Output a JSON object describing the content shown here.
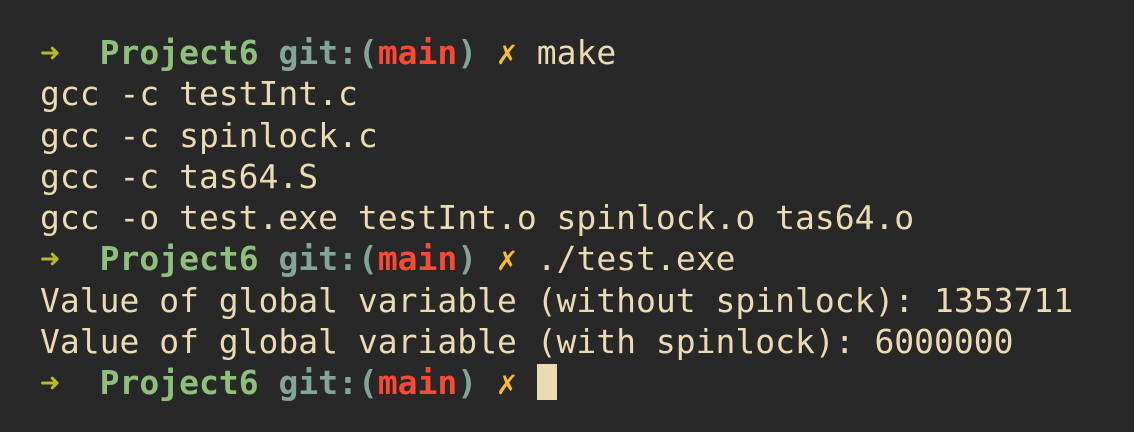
{
  "colors": {
    "background": "#282828",
    "foreground": "#ebdbb2",
    "prompt_arrow": "#b8bb26",
    "directory": "#8ec07c",
    "git_label": "#83a598",
    "branch": "#fb4934",
    "dirty_marker": "#fabd2f"
  },
  "prompt": {
    "arrow": "➜",
    "directory": "Project6",
    "git_label": "git:",
    "paren_open": "(",
    "branch": "main",
    "paren_close": ")",
    "dirty": "✗"
  },
  "lines": [
    {
      "type": "prompt",
      "command": "make"
    },
    {
      "type": "output",
      "text": "gcc -c testInt.c"
    },
    {
      "type": "output",
      "text": "gcc -c spinlock.c"
    },
    {
      "type": "output",
      "text": "gcc -c tas64.S"
    },
    {
      "type": "output",
      "text": "gcc -o test.exe testInt.o spinlock.o tas64.o"
    },
    {
      "type": "prompt",
      "command": "./test.exe"
    },
    {
      "type": "output",
      "text": "Value of global variable (without spinlock): 1353711"
    },
    {
      "type": "output",
      "text": "Value of global variable (with spinlock): 6000000"
    },
    {
      "type": "prompt",
      "command": ""
    }
  ]
}
